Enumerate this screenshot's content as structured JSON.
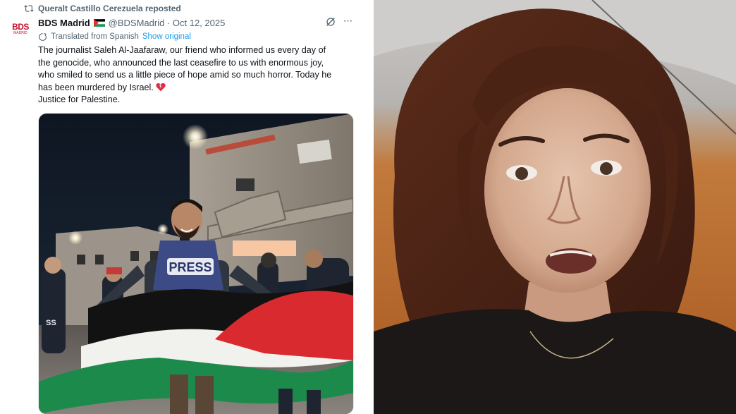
{
  "tweet": {
    "repost_text": "Queralt Castillo Cerezuela reposted",
    "avatar_text": "BDS",
    "avatar_subtext": "MADRID",
    "author_name": "BDS Madrid",
    "handle_and_date": "@BDSMadrid · Oct 12, 2025",
    "translated_label": "Translated from Spanish",
    "show_original": "Show original",
    "more_label": "···",
    "text_lines": [
      "The journalist Saleh Al-Jaafaraw, our friend who informed us every day of",
      "the genocide, who announced the last ceasefire to us with enormous joy,",
      "who smiled to send us a little piece of hope amid so much horror. Today he",
      "has been murdered by Israel.",
      "Justice for Palestine."
    ],
    "photo_vest_label": "PRESS",
    "photo_vest_label_small": "SS"
  },
  "colors": {
    "text_primary": "#0f1419",
    "text_secondary": "#536471",
    "link": "#1d9bf0",
    "bds_red": "#c8102e"
  },
  "icons": {
    "repost": "repost-icon",
    "flag": "palestine-flag-icon",
    "grok": "grok-icon",
    "more": "more-icon",
    "translate": "translate-icon",
    "heart": "broken-heart-icon"
  }
}
